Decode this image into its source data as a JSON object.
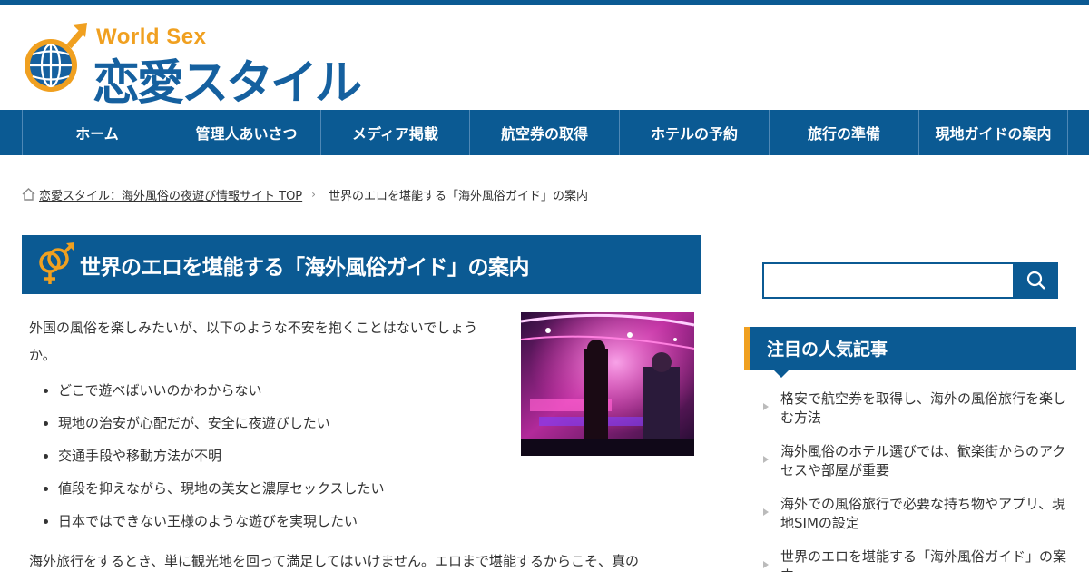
{
  "site": {
    "logo_en": "World Sex",
    "logo_jp": "恋愛スタイル",
    "brand_blue": "#0b5a93",
    "accent_orange": "#f0a020"
  },
  "nav": {
    "items": [
      {
        "label": "ホーム"
      },
      {
        "label": "管理人あいさつ"
      },
      {
        "label": "メディア掲載"
      },
      {
        "label": "航空券の取得"
      },
      {
        "label": "ホテルの予約"
      },
      {
        "label": "旅行の準備"
      },
      {
        "label": "現地ガイドの案内"
      }
    ]
  },
  "breadcrumb": {
    "home_icon": "home-icon",
    "home_label": "恋愛スタイル：海外風俗の夜遊び情報サイト TOP",
    "separator": "›",
    "current": "世界のエロを堪能する「海外風俗ガイド」の案内"
  },
  "article": {
    "title_icon": "gender-symbol-icon",
    "title": "世界のエロを堪能する「海外風俗ガイド」の案内",
    "intro": "外国の風俗を楽しみたいが、以下のような不安を抱くことはないでしょうか。",
    "bullets": [
      "どこで遊べばいいのかわからない",
      "現地の治安が心配だが、安全に夜遊びしたい",
      "交通手段や移動方法が不明",
      "値段を抑えながら、現地の美女と濃厚セックスしたい",
      "日本ではできない王様のような遊びを実現したい"
    ],
    "paragraph": "海外旅行をするとき、単に観光地を回って満足してはいけません。エロまで堪能するからこそ、真の"
  },
  "sidebar": {
    "search": {
      "placeholder": "",
      "button_icon": "search-icon"
    },
    "popular": {
      "heading": "注目の人気記事",
      "items": [
        "格安で航空券を取得し、海外の風俗旅行を楽しむ方法",
        "海外風俗のホテル選びでは、歓楽街からのアクセスや部屋が重要",
        "海外での風俗旅行で必要な持ち物やアプリ、現地SIMの設定",
        "世界のエロを堪能する「海外風俗ガイド」の案内"
      ]
    }
  }
}
